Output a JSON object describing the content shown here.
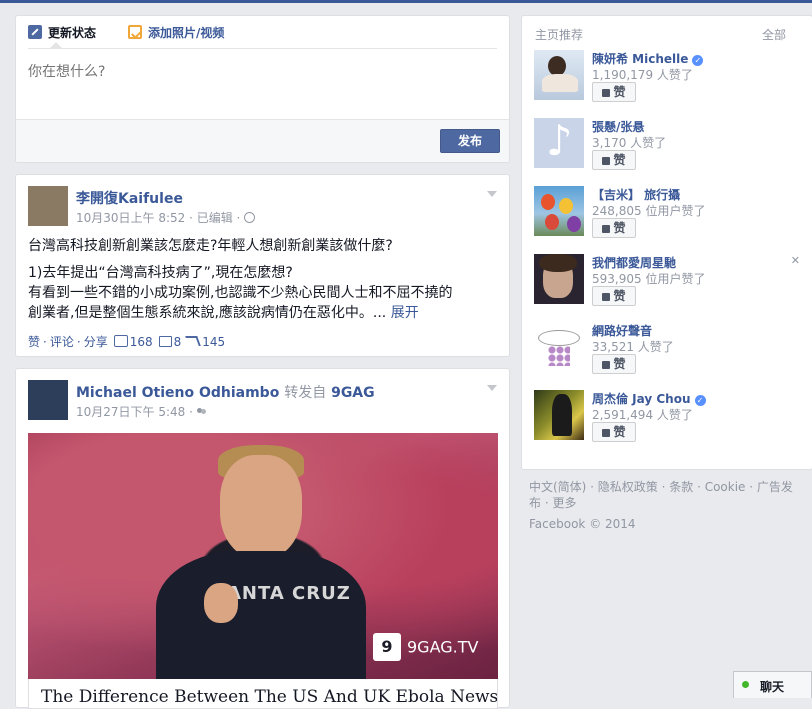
{
  "composer": {
    "tab_status": "更新状态",
    "tab_photo": "添加照片/视频",
    "placeholder": "你在想什么?",
    "publish": "发布"
  },
  "story1": {
    "actor": "李開復Kaifulee",
    "meta": "10月30日上午 8:52 · 已编辑 · ",
    "line1": "台灣高科技創新創業該怎麼走?年輕人想創新創業該做什麼?",
    "line2": "1)去年提出“台灣高科技病了”,現在怎麼想?",
    "line3": "有看到一些不錯的小成功案例,也認識不少熱心民間人士和不屈不撓的",
    "line4": "創業者,但是整個生態系統來說,應該說病情仍在惡化中。...",
    "see_more": "展开",
    "actions": {
      "like": "赞",
      "comment": "评论",
      "share": "分享",
      "likes_count": "168",
      "comments_count": "8",
      "shares_count": "145"
    }
  },
  "story2": {
    "actor": "Michael Otieno Odhiambo",
    "via": "转发自",
    "source": "9GAG",
    "meta": "10月27日下午 5:48 · ",
    "video": {
      "shirt_text": "SANTA CRUZ",
      "badge": "9",
      "watermark": "9GAG.TV",
      "caption": "The Difference Between The US And UK Ebola News"
    }
  },
  "rhc": {
    "title": "主页推荐",
    "all": "全部",
    "like_label": "赞",
    "pages": [
      {
        "name": "陳妍希 Michelle",
        "verified": true,
        "likes": "1,190,179 人赞了",
        "thumb": "woman-photo"
      },
      {
        "name": "張懸/张悬",
        "verified": false,
        "likes": "3,170 人赞了",
        "thumb": "music-note-icon"
      },
      {
        "name": "【吉米】 旅行攝",
        "verified": false,
        "likes": "248,805 位用户赞了",
        "thumb": "hot-air-balloons-photo"
      },
      {
        "name": "我們都愛周星馳",
        "verified": false,
        "likes": "593,905 位用户赞了",
        "thumb": "actor-photo"
      },
      {
        "name": "網路好聲音",
        "verified": false,
        "likes": "33,521 人赞了",
        "thumb": "music-logo"
      },
      {
        "name": "周杰倫 Jay Chou",
        "verified": true,
        "likes": "2,591,494 人赞了",
        "thumb": "album-cover"
      }
    ]
  },
  "footer": {
    "links_text": "中文(简体) · 隐私权政策 · 条款 · Cookie · 广告发布 · 更多",
    "copyright": "Facebook © 2014"
  },
  "chat": {
    "label": "聊天"
  }
}
